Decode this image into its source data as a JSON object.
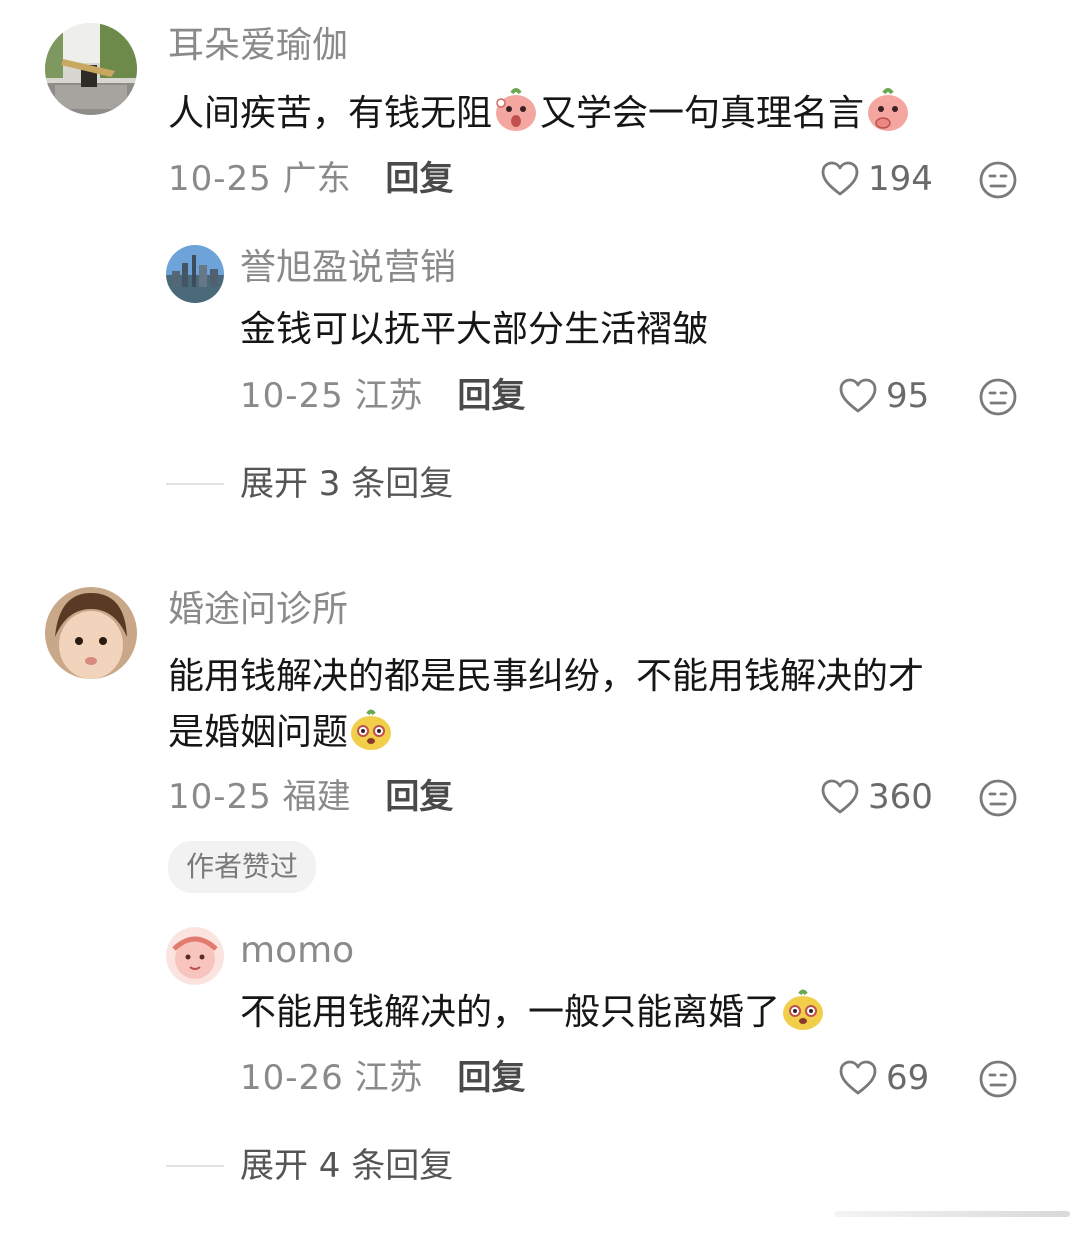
{
  "threads": [
    {
      "comment": {
        "username": "耳朵爱瑜伽",
        "lines": [
          {
            "text_a": "人间疾苦，有钱无阻",
            "text_b": "又学会一句真理名言",
            "emojis": [
              "pig-wow-emoji",
              "pig-think-emoji"
            ]
          }
        ],
        "date": "10-25",
        "region": "广东",
        "reply_label": "回复",
        "likes": "194"
      },
      "reply": {
        "username": "誉旭盈说营销",
        "text": "金钱可以抚平大部分生活褶皱",
        "date": "10-25",
        "region": "江苏",
        "reply_label": "回复",
        "likes": "95"
      },
      "expand_label": "展开 3 条回复"
    },
    {
      "comment": {
        "username": "婚途问诊所",
        "line1": "能用钱解决的都是民事纠纷，不能用钱解决的才",
        "line2": "是婚姻问题",
        "date": "10-25",
        "region": "福建",
        "reply_label": "回复",
        "likes": "360",
        "badge": "作者赞过"
      },
      "reply": {
        "username": "momo",
        "text": "不能用钱解决的，一般只能离婚了",
        "date": "10-26",
        "region": "江苏",
        "reply_label": "回复",
        "likes": "69"
      },
      "expand_label": "展开 4 条回复"
    }
  ],
  "icons": {
    "like": "heart-outline-icon",
    "more": "neutral-face-icon",
    "emoji_a": "pig-wow-emoji",
    "emoji_b": "pig-think-emoji",
    "emoji_c": "yellow-doge-emoji"
  },
  "colors": {
    "username": "#8a8a8a",
    "content": "#161616",
    "meta": "#8a8a8a",
    "reply_button": "#4a4a4a",
    "badge_bg": "#f2f2f2"
  }
}
